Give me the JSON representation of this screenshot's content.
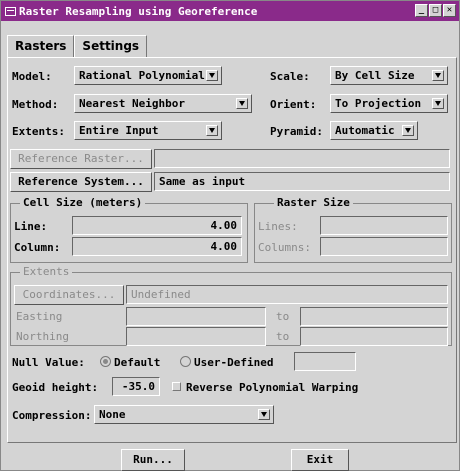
{
  "window": {
    "title": "Raster Resampling using Georeference"
  },
  "tabs": [
    {
      "label": "Rasters"
    },
    {
      "label": "Settings"
    }
  ],
  "settings": {
    "model_label": "Model:",
    "model_value": "Rational Polynomial",
    "scale_label": "Scale:",
    "scale_value": "By Cell Size",
    "method_label": "Method:",
    "method_value": "Nearest Neighbor",
    "orient_label": "Orient:",
    "orient_value": "To Projection",
    "extents_label": "Extents:",
    "extents_value": "Entire Input",
    "pyramid_label": "Pyramid:",
    "pyramid_value": "Automatic",
    "reference_raster_button": "Reference Raster...",
    "reference_raster_value": "",
    "reference_system_button": "Reference System...",
    "reference_system_value": "Same as input"
  },
  "cell_size": {
    "title": "Cell Size (meters)",
    "line_label": "Line:",
    "line_value": "4.00",
    "column_label": "Column:",
    "column_value": "4.00"
  },
  "raster_size": {
    "title": "Raster Size",
    "lines_label": "Lines:",
    "lines_value": "",
    "columns_label": "Columns:",
    "columns_value": ""
  },
  "extents_group": {
    "title": "Extents",
    "coordinates_button": "Coordinates...",
    "coordinates_value": "Undefined",
    "easting_label": "Easting",
    "northing_label": "Northing",
    "to_label": "to"
  },
  "null_value": {
    "label": "Null Value:",
    "default_label": "Default",
    "user_defined_label": "User-Defined",
    "user_value": ""
  },
  "geoid": {
    "label": "Geoid height:",
    "value": "-35.0",
    "reverse_label": "Reverse Polynomial Warping"
  },
  "compression": {
    "label": "Compression:",
    "value": "None"
  },
  "footer": {
    "run_label": "Run...",
    "exit_label": "Exit"
  }
}
